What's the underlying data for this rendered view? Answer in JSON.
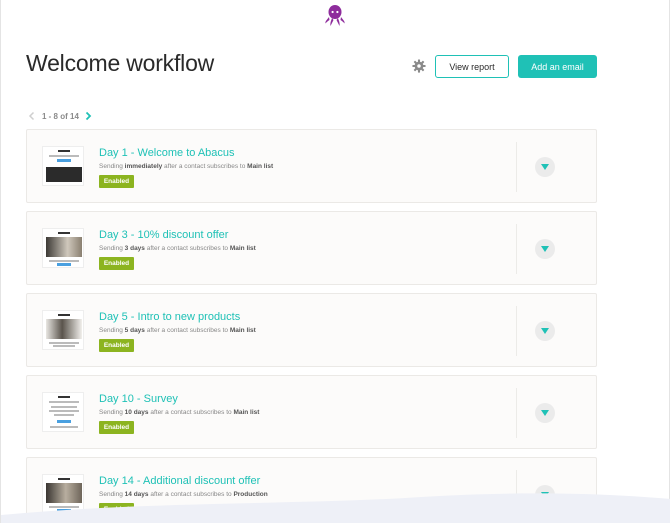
{
  "app": {
    "logo_icon": "octopus-icon",
    "brand_color": "#8e2c9c",
    "accent": "#1fc1b6",
    "enabled_color": "#8cb420"
  },
  "header": {
    "title": "Welcome workflow",
    "settings_icon": "gear-icon",
    "view_report_label": "View report",
    "add_email_label": "Add an email"
  },
  "pager": {
    "range": "1 - 8 of 14"
  },
  "emails": [
    {
      "title": "Day 1 - Welcome to Abacus",
      "sub_pre": "Sending ",
      "sub_bold": "immediately",
      "sub_mid": " after a contact subscribes to ",
      "sub_list": "Main list",
      "status": "Enabled"
    },
    {
      "title": "Day 3 - 10% discount offer",
      "sub_pre": "Sending ",
      "sub_bold": "3 days",
      "sub_mid": " after a contact subscribes to ",
      "sub_list": "Main list",
      "status": "Enabled"
    },
    {
      "title": "Day 5 - Intro to new products",
      "sub_pre": "Sending ",
      "sub_bold": "5 days",
      "sub_mid": " after a contact subscribes to ",
      "sub_list": "Main list",
      "status": "Enabled"
    },
    {
      "title": "Day 10 - Survey",
      "sub_pre": "Sending ",
      "sub_bold": "10 days",
      "sub_mid": " after a contact subscribes to ",
      "sub_list": "Main list",
      "status": "Enabled"
    },
    {
      "title": "Day 14 - Additional discount offer",
      "sub_pre": "Sending ",
      "sub_bold": "14 days",
      "sub_mid": " after a contact subscribes to ",
      "sub_list": "Production",
      "status": "Enabled"
    }
  ]
}
